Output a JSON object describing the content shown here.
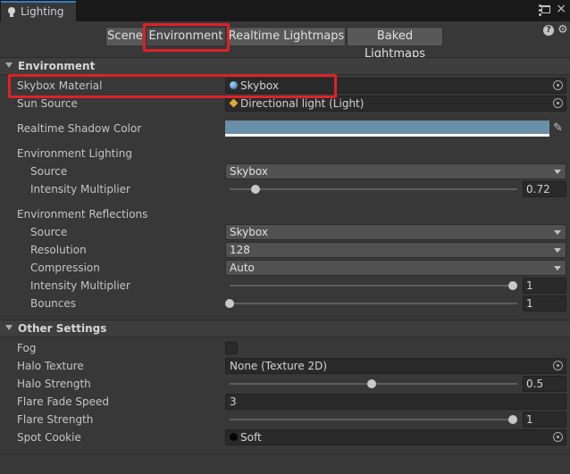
{
  "window": {
    "title": "Lighting",
    "icon": "lightbulb-icon",
    "close_glyph": "×"
  },
  "tabs": [
    {
      "label": "Scene"
    },
    {
      "label": "Environment",
      "active": true
    },
    {
      "label": "Realtime Lightmaps"
    },
    {
      "label": "Baked Lightmaps"
    }
  ],
  "header_icons": {
    "help": "?",
    "settings": "⚙"
  },
  "environment": {
    "title": "Environment",
    "skybox_material": {
      "label": "Skybox Material",
      "value": "Skybox",
      "icon": "skybox-material-icon"
    },
    "sun_source": {
      "label": "Sun Source",
      "value": "Directional light (Light)",
      "icon": "directional-light-icon"
    },
    "realtime_shadow_color": {
      "label": "Realtime Shadow Color",
      "color": "#6a8fa8"
    },
    "environment_lighting": {
      "label": "Environment Lighting",
      "source": {
        "label": "Source",
        "value": "Skybox"
      },
      "intensity_multiplier": {
        "label": "Intensity Multiplier",
        "value": "0.72"
      }
    },
    "environment_reflections": {
      "label": "Environment Reflections",
      "source": {
        "label": "Source",
        "value": "Skybox"
      },
      "resolution": {
        "label": "Resolution",
        "value": "128"
      },
      "compression": {
        "label": "Compression",
        "value": "Auto"
      },
      "intensity_multiplier": {
        "label": "Intensity Multiplier",
        "value": "1"
      },
      "bounces": {
        "label": "Bounces",
        "value": "1"
      }
    }
  },
  "other_settings": {
    "title": "Other Settings",
    "fog": {
      "label": "Fog",
      "checked": false
    },
    "halo_texture": {
      "label": "Halo Texture",
      "value": "None (Texture 2D)"
    },
    "halo_strength": {
      "label": "Halo Strength",
      "value": "0.5"
    },
    "flare_fade_speed": {
      "label": "Flare Fade Speed",
      "value": "3"
    },
    "flare_strength": {
      "label": "Flare Strength",
      "value": "1"
    },
    "spot_cookie": {
      "label": "Spot Cookie",
      "value": "Soft",
      "icon": "texture-icon"
    }
  },
  "colors": {
    "highlight": "#e02028",
    "active_tab_accent": "#3a79bb",
    "panel_background": "#383838"
  }
}
